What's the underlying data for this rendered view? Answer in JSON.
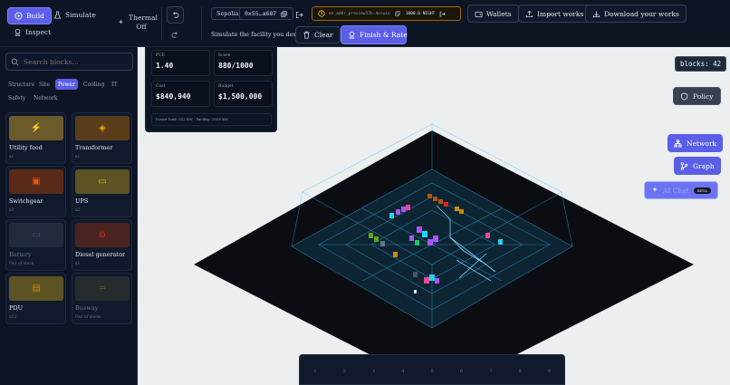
{
  "topbar": {
    "modes": {
      "build": "Build",
      "simulate": "Simulate",
      "thermal": "Thermal Off",
      "inspect": "Inspect"
    },
    "network_chip": "Sepolia",
    "address_chip": "0x55…a687",
    "ens_chip": "en_addr_preview17h.4eswin",
    "balance_chip": "1000.0 NIGHT",
    "hint": "Simulate the facility you designed",
    "clear_label": "Clear",
    "finish_label": "Finish & Rate",
    "wallets_label": "Wallets",
    "import_label": "Import works",
    "download_label": "Download your works"
  },
  "left_panel": {
    "search_placeholder": "Search blocks…",
    "categories": [
      "Structure",
      "Site",
      "Power",
      "Cooling",
      "IT",
      "Safety",
      "Network"
    ],
    "active_category": "Power",
    "blocks": [
      {
        "name": "Utility feed",
        "meta": "x1",
        "icon": "lightning-icon",
        "tint": "#6b5a2a",
        "glyph": "#fcd34d",
        "symbol": "⚡"
      },
      {
        "name": "Transformer",
        "meta": "x1",
        "icon": "transformer-icon",
        "tint": "#5a3d1a",
        "glyph": "#f59e0b",
        "symbol": "◈"
      },
      {
        "name": "Switchgear",
        "meta": "x3",
        "icon": "switchgear-icon",
        "tint": "#5a2a18",
        "glyph": "#ea580c",
        "symbol": "▣"
      },
      {
        "name": "UPS",
        "meta": "x2",
        "icon": "battery-icon",
        "tint": "#5c5224",
        "glyph": "#eab308",
        "symbol": "▭"
      },
      {
        "name": "Battery",
        "meta": "Out of stock",
        "icon": "battery-icon",
        "tint": "#2a3342",
        "glyph": "#64748b",
        "symbol": "▭",
        "disabled": true
      },
      {
        "name": "Diesel generator",
        "meta": "x1",
        "icon": "generator-icon",
        "tint": "#4a2420",
        "glyph": "#dc2626",
        "symbol": "⊙"
      },
      {
        "name": "PDU",
        "meta": "x12",
        "icon": "pdu-icon",
        "tint": "#5c5224",
        "glyph": "#ca8a04",
        "symbol": "▤"
      },
      {
        "name": "Busway",
        "meta": "Out of stock",
        "icon": "busway-icon",
        "tint": "#2f3330",
        "glyph": "#a16207",
        "symbol": "═",
        "disabled": true
      }
    ]
  },
  "stats": {
    "pue_label": "PUE",
    "pue_value": "1.40",
    "score_label": "Score",
    "score_value": "880/1000",
    "cost_label": "Cost",
    "cost_value": "$840,940",
    "budget_label": "Budget",
    "budget_value": "$1,500,000",
    "footnote": "Power load: 512 kW · Facility: 2005 kW"
  },
  "viewport": {
    "blocks_counter": "blocks: 42",
    "policy_label": "Policy",
    "network_label": "Network",
    "graph_label": "Graph",
    "ai_label": "AI Chat",
    "ai_badge": "BETA",
    "slots": [
      "1",
      "2",
      "3",
      "4",
      "5",
      "6",
      "7",
      "8",
      "9"
    ]
  },
  "colors": {
    "accent": "#5b5fe6",
    "panel": "#0d1424",
    "viewport": "#eceef0",
    "wire": "#38bdf8"
  }
}
